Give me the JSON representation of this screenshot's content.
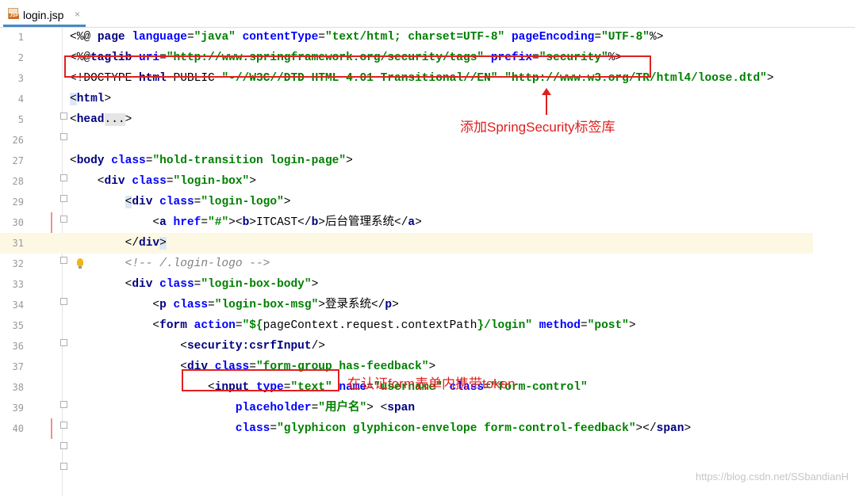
{
  "tab": {
    "filename": "login.jsp",
    "close_glyph": "×",
    "icon_label": "JSP"
  },
  "lines": [
    {
      "num": "1",
      "parts": [
        {
          "c": "d",
          "t": "<%@ "
        },
        {
          "c": "k",
          "t": "page "
        },
        {
          "c": "a",
          "t": "language"
        },
        {
          "c": "d",
          "t": "="
        },
        {
          "c": "v",
          "t": "\"java\" "
        },
        {
          "c": "a",
          "t": "contentType"
        },
        {
          "c": "d",
          "t": "="
        },
        {
          "c": "v",
          "t": "\"text/html; charset=UTF-8\" "
        },
        {
          "c": "a",
          "t": "pageEncoding"
        },
        {
          "c": "d",
          "t": "="
        },
        {
          "c": "v",
          "t": "\"UTF-8\""
        },
        {
          "c": "d",
          "t": "%>"
        }
      ]
    },
    {
      "num": "2",
      "parts": [
        {
          "c": "d",
          "t": "<%@"
        },
        {
          "c": "k",
          "t": "taglib "
        },
        {
          "c": "a",
          "t": "uri"
        },
        {
          "c": "d",
          "t": "="
        },
        {
          "c": "v",
          "t": "\"http://www.springframework.org/security/tags\" "
        },
        {
          "c": "a",
          "t": "prefix"
        },
        {
          "c": "d",
          "t": "="
        },
        {
          "c": "v",
          "t": "\"security\""
        },
        {
          "c": "d",
          "t": "%>"
        }
      ]
    },
    {
      "num": "3",
      "parts": [
        {
          "c": "d",
          "t": "<!DOCTYPE "
        },
        {
          "c": "k",
          "t": "html "
        },
        {
          "c": "d",
          "t": "PUBLIC "
        },
        {
          "c": "v",
          "t": "\"-//W3C//DTD HTML 4.01 Transitional//EN\" \"http://www.w3.org/TR/html4/loose.dtd\""
        },
        {
          "c": "d",
          "t": ">"
        }
      ]
    },
    {
      "num": "4",
      "parts": [
        {
          "c": "tagbg",
          "t": "<"
        },
        {
          "c": "t",
          "t": "html"
        },
        {
          "c": "d",
          "t": ">"
        }
      ]
    },
    {
      "num": "5",
      "parts": [
        {
          "c": "d",
          "t": "<"
        },
        {
          "c": "t",
          "t": "head"
        },
        {
          "c": "fold-dots",
          "t": "..."
        },
        {
          "c": "d",
          "t": ">"
        }
      ]
    },
    {
      "num": "26",
      "parts": []
    },
    {
      "num": "27",
      "parts": [
        {
          "c": "d",
          "t": "<"
        },
        {
          "c": "t",
          "t": "body "
        },
        {
          "c": "a",
          "t": "class"
        },
        {
          "c": "d",
          "t": "="
        },
        {
          "c": "v",
          "t": "\"hold-transition login-page\""
        },
        {
          "c": "d",
          "t": ">"
        }
      ]
    },
    {
      "num": "28",
      "parts": [
        {
          "c": "d",
          "t": "    <"
        },
        {
          "c": "t",
          "t": "div "
        },
        {
          "c": "a",
          "t": "class"
        },
        {
          "c": "d",
          "t": "="
        },
        {
          "c": "v",
          "t": "\"login-box\""
        },
        {
          "c": "d",
          "t": ">"
        }
      ]
    },
    {
      "num": "29",
      "parts": [
        {
          "c": "d",
          "t": "        "
        },
        {
          "c": "tagbg",
          "t": "<"
        },
        {
          "c": "t",
          "t": "div "
        },
        {
          "c": "a",
          "t": "class"
        },
        {
          "c": "d",
          "t": "="
        },
        {
          "c": "v",
          "t": "\"login-logo\""
        },
        {
          "c": "d",
          "t": ">"
        }
      ]
    },
    {
      "num": "30",
      "parts": [
        {
          "c": "d",
          "t": "            <"
        },
        {
          "c": "t",
          "t": "a "
        },
        {
          "c": "a",
          "t": "href"
        },
        {
          "c": "d",
          "t": "="
        },
        {
          "c": "v",
          "t": "\"#\""
        },
        {
          "c": "d",
          "t": "><"
        },
        {
          "c": "t",
          "t": "b"
        },
        {
          "c": "d",
          "t": ">ITCAST</"
        },
        {
          "c": "t",
          "t": "b"
        },
        {
          "c": "d",
          "t": ">后台管理系统</"
        },
        {
          "c": "t",
          "t": "a"
        },
        {
          "c": "d",
          "t": ">"
        }
      ]
    },
    {
      "num": "31",
      "parts": [
        {
          "c": "d",
          "t": "        </"
        },
        {
          "c": "t",
          "t": "div"
        },
        {
          "c": "tagbg",
          "t": ">"
        }
      ]
    },
    {
      "num": "32",
      "parts": [
        {
          "c": "c",
          "t": "        <!-- /.login-logo -->"
        }
      ]
    },
    {
      "num": "33",
      "parts": [
        {
          "c": "d",
          "t": "        <"
        },
        {
          "c": "t",
          "t": "div "
        },
        {
          "c": "a",
          "t": "class"
        },
        {
          "c": "d",
          "t": "="
        },
        {
          "c": "v",
          "t": "\"login-box-body\""
        },
        {
          "c": "d",
          "t": ">"
        }
      ]
    },
    {
      "num": "34",
      "parts": [
        {
          "c": "d",
          "t": "            <"
        },
        {
          "c": "t",
          "t": "p "
        },
        {
          "c": "a",
          "t": "class"
        },
        {
          "c": "d",
          "t": "="
        },
        {
          "c": "v",
          "t": "\"login-box-msg\""
        },
        {
          "c": "d",
          "t": ">登录系统</"
        },
        {
          "c": "t",
          "t": "p"
        },
        {
          "c": "d",
          "t": ">"
        }
      ]
    },
    {
      "num": "35",
      "parts": [
        {
          "c": "d",
          "t": "            <"
        },
        {
          "c": "t",
          "t": "form "
        },
        {
          "c": "a",
          "t": "action"
        },
        {
          "c": "d",
          "t": "="
        },
        {
          "c": "v",
          "t": "\"${"
        },
        {
          "c": "d",
          "t": "pageContext.request.contextPath"
        },
        {
          "c": "v",
          "t": "}/login\" "
        },
        {
          "c": "a",
          "t": "method"
        },
        {
          "c": "d",
          "t": "="
        },
        {
          "c": "v",
          "t": "\"post\""
        },
        {
          "c": "d",
          "t": ">"
        }
      ]
    },
    {
      "num": "36",
      "parts": [
        {
          "c": "d",
          "t": "                <"
        },
        {
          "c": "t",
          "t": "security:csrfInput"
        },
        {
          "c": "d",
          "t": "/>"
        }
      ]
    },
    {
      "num": "37",
      "parts": [
        {
          "c": "d",
          "t": "                <"
        },
        {
          "c": "t",
          "t": "div "
        },
        {
          "c": "a",
          "t": "class"
        },
        {
          "c": "d",
          "t": "="
        },
        {
          "c": "v",
          "t": "\"form-group has-feedback\""
        },
        {
          "c": "d",
          "t": ">"
        }
      ]
    },
    {
      "num": "38",
      "parts": [
        {
          "c": "d",
          "t": "                    <"
        },
        {
          "c": "t",
          "t": "input "
        },
        {
          "c": "a",
          "t": "type"
        },
        {
          "c": "d",
          "t": "="
        },
        {
          "c": "v",
          "t": "\"text\" "
        },
        {
          "c": "a",
          "t": "name"
        },
        {
          "c": "d",
          "t": "="
        },
        {
          "c": "v",
          "t": "\"username\" "
        },
        {
          "c": "a",
          "t": "class"
        },
        {
          "c": "d",
          "t": "="
        },
        {
          "c": "v",
          "t": "\"form-control\""
        }
      ]
    },
    {
      "num": "39",
      "parts": [
        {
          "c": "d",
          "t": "                        "
        },
        {
          "c": "a",
          "t": "placeholder"
        },
        {
          "c": "d",
          "t": "="
        },
        {
          "c": "v",
          "t": "\"用户名\""
        },
        {
          "c": "d",
          "t": "> <"
        },
        {
          "c": "t",
          "t": "span"
        }
      ]
    },
    {
      "num": "40",
      "parts": [
        {
          "c": "d",
          "t": "                        "
        },
        {
          "c": "a",
          "t": "class"
        },
        {
          "c": "d",
          "t": "="
        },
        {
          "c": "v",
          "t": "\"glyphicon glyphicon-envelope form-control-feedback\""
        },
        {
          "c": "d",
          "t": "></"
        },
        {
          "c": "t",
          "t": "span"
        },
        {
          "c": "d",
          "t": ">"
        }
      ]
    }
  ],
  "annotations": {
    "taglib_note": "添加SpringSecurity标签库",
    "csrf_note": "在认证form表单内携带token"
  },
  "watermark": "https://blog.csdn.net/SSbandianH",
  "colors": {
    "annotation": "#e02020",
    "current_line": "#fcf8e4",
    "tab_underline": "#4a88c7"
  }
}
